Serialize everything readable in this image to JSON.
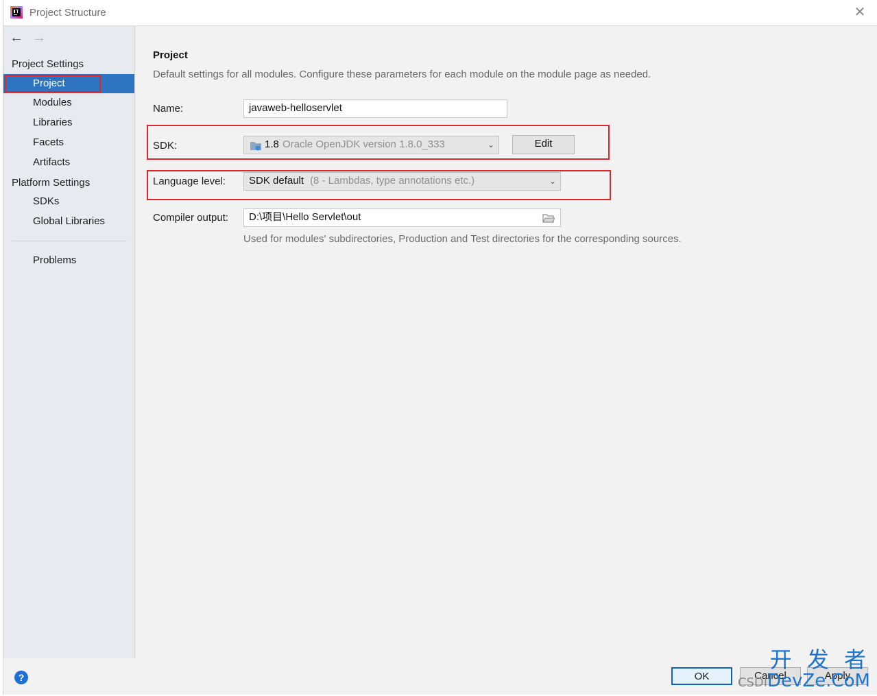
{
  "window": {
    "title": "Project Structure",
    "close_glyph": "✕"
  },
  "nav": {
    "back": "←",
    "forward": "→"
  },
  "sidebar": {
    "project_settings_header": "Project Settings",
    "project_items": [
      "Project",
      "Modules",
      "Libraries",
      "Facets",
      "Artifacts"
    ],
    "platform_settings_header": "Platform Settings",
    "platform_items": [
      "SDKs",
      "Global Libraries"
    ],
    "problems": "Problems",
    "selected": "Project"
  },
  "main": {
    "heading": "Project",
    "description": "Default settings for all modules. Configure these parameters for each module on the module page as needed.",
    "name_label": "Name:",
    "name_value": "javaweb-helloservlet",
    "sdk_label": "SDK:",
    "sdk_version": "1.8",
    "sdk_detail": "Oracle OpenJDK version 1.8.0_333",
    "edit_button": "Edit",
    "language_level_label": "Language level:",
    "language_level_value": "SDK default",
    "language_level_detail": "(8 - Lambdas, type annotations etc.)",
    "compiler_output_label": "Compiler output:",
    "compiler_output_value": "D:\\项目\\Hello Servlet\\out",
    "compiler_output_hint": "Used for modules' subdirectories, Production and Test directories for the corresponding sources."
  },
  "footer": {
    "help": "?",
    "ok": "OK",
    "cancel": "Cancel",
    "apply": "Apply"
  },
  "watermark": {
    "line1": "开 发 者",
    "line2": "DevZe.CoM",
    "prefix": "CSDI"
  },
  "colors": {
    "selection": "#2f74c0",
    "highlight_box": "#e0252b",
    "ok_border": "#0d62c5"
  }
}
